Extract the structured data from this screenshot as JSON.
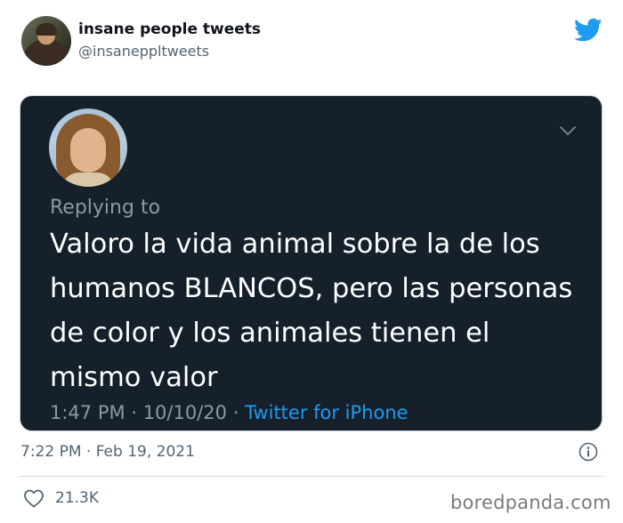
{
  "author": {
    "display_name": "insane people tweets",
    "handle": "@insanepp‌ltweets"
  },
  "embedded_tweet": {
    "replying_to_label": "Replying to",
    "text": "Valoro la vida animal sobre la de los humanos BLANCOS, pero las personas de color y los animales tienen el mismo valor",
    "time": "1:47 PM",
    "separator": "·",
    "date": "10/10/20",
    "source": "Twitter for iPhone"
  },
  "tweet": {
    "timestamp": "7:22 PM · Feb 19, 2021",
    "likes": "21.3K"
  },
  "watermark": "boredpanda.com",
  "colors": {
    "twitter_blue": "#1d9bf0",
    "dark_card": "#15202b",
    "muted_text": "#536471"
  },
  "icons": {
    "brand": "twitter-bird-icon",
    "caret": "chevron-down-icon",
    "info": "info-icon",
    "like": "heart-icon"
  }
}
